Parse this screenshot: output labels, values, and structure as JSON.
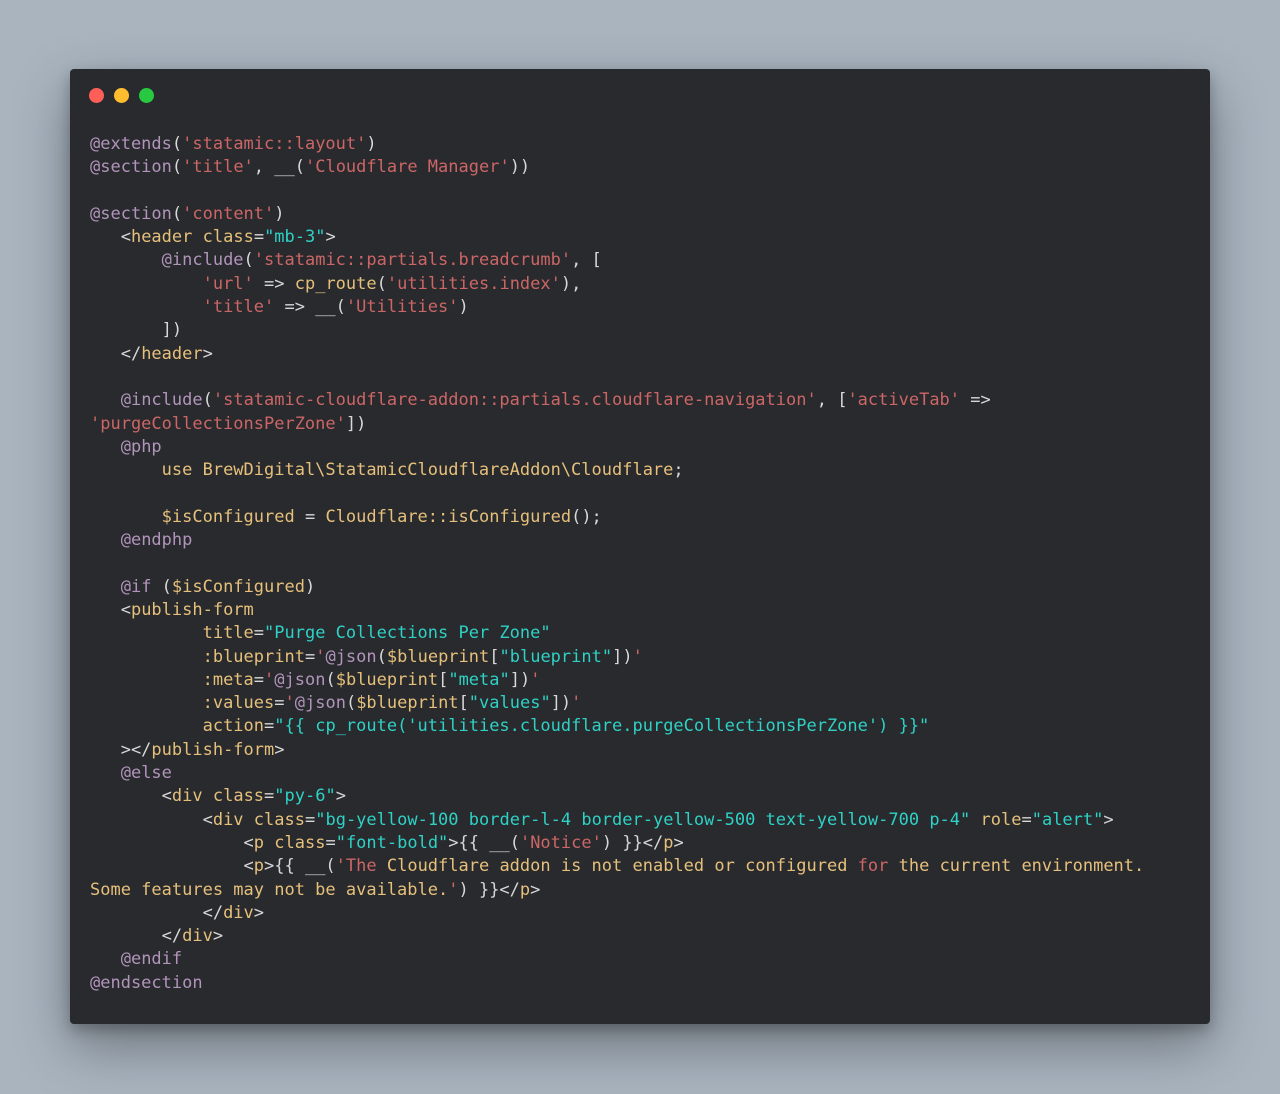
{
  "window": {
    "controls": [
      {
        "name": "close-button",
        "color": "#ff5f57"
      },
      {
        "name": "minimize-button",
        "color": "#febc2e"
      },
      {
        "name": "zoom-button",
        "color": "#28c840"
      }
    ]
  },
  "colors": {
    "background": "#a9b4bf",
    "editor": "#282a2e",
    "directive": "#b294bb",
    "string": "#cc6666",
    "identifier": "#e6c07b",
    "attribute_value": "#2fd1c5",
    "plain": "#d8d8d8"
  },
  "code": {
    "language": "blade",
    "lines": [
      [
        [
          "directive",
          "@extends"
        ],
        [
          "punct",
          "("
        ],
        [
          "string",
          "'statamic::layout'"
        ],
        [
          "punct",
          ")"
        ]
      ],
      [
        [
          "directive",
          "@section"
        ],
        [
          "punct",
          "("
        ],
        [
          "string",
          "'title'"
        ],
        [
          "punct",
          ", __("
        ],
        [
          "string",
          "'Cloudflare Manager'"
        ],
        [
          "punct",
          "))"
        ]
      ],
      [],
      [
        [
          "directive",
          "@section"
        ],
        [
          "punct",
          "("
        ],
        [
          "string",
          "'content'"
        ],
        [
          "punct",
          ")"
        ]
      ],
      [
        [
          "default",
          "   <"
        ],
        [
          "text",
          "header"
        ],
        [
          "default",
          " "
        ],
        [
          "attr",
          "class"
        ],
        [
          "punct",
          "="
        ],
        [
          "attrval",
          "\"mb-3\""
        ],
        [
          "punct",
          ">"
        ]
      ],
      [
        [
          "default",
          "       "
        ],
        [
          "directive",
          "@include"
        ],
        [
          "punct",
          "("
        ],
        [
          "string",
          "'statamic::partials.breadcrumb'"
        ],
        [
          "punct",
          ", ["
        ]
      ],
      [
        [
          "default",
          "           "
        ],
        [
          "string",
          "'url'"
        ],
        [
          "punct",
          " => "
        ],
        [
          "func",
          "cp_route"
        ],
        [
          "punct",
          "("
        ],
        [
          "string",
          "'utilities.index'"
        ],
        [
          "punct",
          "),"
        ]
      ],
      [
        [
          "default",
          "           "
        ],
        [
          "string",
          "'title'"
        ],
        [
          "punct",
          " => __("
        ],
        [
          "string",
          "'Utilities'"
        ],
        [
          "punct",
          ")"
        ]
      ],
      [
        [
          "default",
          "       ])"
        ]
      ],
      [
        [
          "default",
          "   </"
        ],
        [
          "text",
          "header"
        ],
        [
          "punct",
          ">"
        ]
      ],
      [],
      [
        [
          "default",
          "   "
        ],
        [
          "directive",
          "@include"
        ],
        [
          "punct",
          "("
        ],
        [
          "string",
          "'statamic-cloudflare-addon::partials.cloudflare-navigation'"
        ],
        [
          "punct",
          ", ["
        ],
        [
          "string",
          "'activeTab'"
        ],
        [
          "punct",
          " =>"
        ]
      ],
      [
        [
          "string",
          "'purgeCollectionsPerZone'"
        ],
        [
          "punct",
          "])"
        ]
      ],
      [
        [
          "default",
          "   "
        ],
        [
          "directive",
          "@php"
        ]
      ],
      [
        [
          "default",
          "       "
        ],
        [
          "text",
          "use BrewDigital\\StatamicCloudflareAddon\\Cloudflare"
        ],
        [
          "punct",
          ";"
        ]
      ],
      [],
      [
        [
          "default",
          "       "
        ],
        [
          "var",
          "$isConfigured"
        ],
        [
          "punct",
          " = "
        ],
        [
          "func",
          "Cloudflare::isConfigured"
        ],
        [
          "punct",
          "();"
        ]
      ],
      [
        [
          "default",
          "   "
        ],
        [
          "directive",
          "@endphp"
        ]
      ],
      [],
      [
        [
          "default",
          "   "
        ],
        [
          "directive",
          "@if"
        ],
        [
          "punct",
          " ("
        ],
        [
          "var",
          "$isConfigured"
        ],
        [
          "punct",
          ")"
        ]
      ],
      [
        [
          "default",
          "   <"
        ],
        [
          "text",
          "publish-form"
        ]
      ],
      [
        [
          "default",
          "           "
        ],
        [
          "attr",
          "title"
        ],
        [
          "punct",
          "="
        ],
        [
          "attrval",
          "\"Purge Collections Per Zone\""
        ]
      ],
      [
        [
          "default",
          "           "
        ],
        [
          "attr",
          ":blueprint"
        ],
        [
          "punct",
          "="
        ],
        [
          "string",
          "'"
        ],
        [
          "directive",
          "@json"
        ],
        [
          "punct",
          "("
        ],
        [
          "var",
          "$blueprint"
        ],
        [
          "punct",
          "["
        ],
        [
          "attrval",
          "\"blueprint\""
        ],
        [
          "punct",
          "])"
        ],
        [
          "string",
          "'"
        ]
      ],
      [
        [
          "default",
          "           "
        ],
        [
          "attr",
          ":meta"
        ],
        [
          "punct",
          "="
        ],
        [
          "string",
          "'"
        ],
        [
          "directive",
          "@json"
        ],
        [
          "punct",
          "("
        ],
        [
          "var",
          "$blueprint"
        ],
        [
          "punct",
          "["
        ],
        [
          "attrval",
          "\"meta\""
        ],
        [
          "punct",
          "])"
        ],
        [
          "string",
          "'"
        ]
      ],
      [
        [
          "default",
          "           "
        ],
        [
          "attr",
          ":values"
        ],
        [
          "punct",
          "="
        ],
        [
          "string",
          "'"
        ],
        [
          "directive",
          "@json"
        ],
        [
          "punct",
          "("
        ],
        [
          "var",
          "$blueprint"
        ],
        [
          "punct",
          "["
        ],
        [
          "attrval",
          "\"values\""
        ],
        [
          "punct",
          "])"
        ],
        [
          "string",
          "'"
        ]
      ],
      [
        [
          "default",
          "           "
        ],
        [
          "attr",
          "action"
        ],
        [
          "punct",
          "="
        ],
        [
          "attrval",
          "\"{{ cp_route('utilities.cloudflare.purgeCollectionsPerZone') }}\""
        ]
      ],
      [
        [
          "default",
          "   ></"
        ],
        [
          "text",
          "publish-form"
        ],
        [
          "punct",
          ">"
        ]
      ],
      [
        [
          "default",
          "   "
        ],
        [
          "directive",
          "@else"
        ]
      ],
      [
        [
          "default",
          "       <"
        ],
        [
          "text",
          "div"
        ],
        [
          "default",
          " "
        ],
        [
          "attr",
          "class"
        ],
        [
          "punct",
          "="
        ],
        [
          "attrval",
          "\"py-6\""
        ],
        [
          "punct",
          ">"
        ]
      ],
      [
        [
          "default",
          "           <"
        ],
        [
          "text",
          "div"
        ],
        [
          "default",
          " "
        ],
        [
          "attr",
          "class"
        ],
        [
          "punct",
          "="
        ],
        [
          "attrval",
          "\"bg-yellow-100 border-l-4 border-yellow-500 text-yellow-700 p-4\""
        ],
        [
          "default",
          " "
        ],
        [
          "attr",
          "role"
        ],
        [
          "punct",
          "="
        ],
        [
          "attrval",
          "\"alert\""
        ],
        [
          "punct",
          ">"
        ]
      ],
      [
        [
          "default",
          "               <"
        ],
        [
          "text",
          "p"
        ],
        [
          "default",
          " "
        ],
        [
          "attr",
          "class"
        ],
        [
          "punct",
          "="
        ],
        [
          "attrval",
          "\"font-bold\""
        ],
        [
          "punct",
          ">{{ __("
        ],
        [
          "string",
          "'Notice'"
        ],
        [
          "punct",
          ") }}</"
        ],
        [
          "text",
          "p"
        ],
        [
          "punct",
          ">"
        ]
      ],
      [
        [
          "default",
          "               <"
        ],
        [
          "text",
          "p"
        ],
        [
          "punct",
          ">{{ __("
        ],
        [
          "string",
          "'The "
        ],
        [
          "text",
          "Cloudflare addon is not enabled or configured "
        ],
        [
          "string",
          "for"
        ],
        [
          "text",
          " the current environment."
        ]
      ],
      [
        [
          "text",
          "Some features may not be available."
        ],
        [
          "string",
          "'"
        ],
        [
          "punct",
          ") }}</"
        ],
        [
          "text",
          "p"
        ],
        [
          "punct",
          ">"
        ]
      ],
      [
        [
          "default",
          "           </"
        ],
        [
          "text",
          "div"
        ],
        [
          "punct",
          ">"
        ]
      ],
      [
        [
          "default",
          "       </"
        ],
        [
          "text",
          "div"
        ],
        [
          "punct",
          ">"
        ]
      ],
      [
        [
          "default",
          "   "
        ],
        [
          "directive",
          "@endif"
        ]
      ],
      [
        [
          "directive",
          "@endsection"
        ]
      ]
    ]
  }
}
